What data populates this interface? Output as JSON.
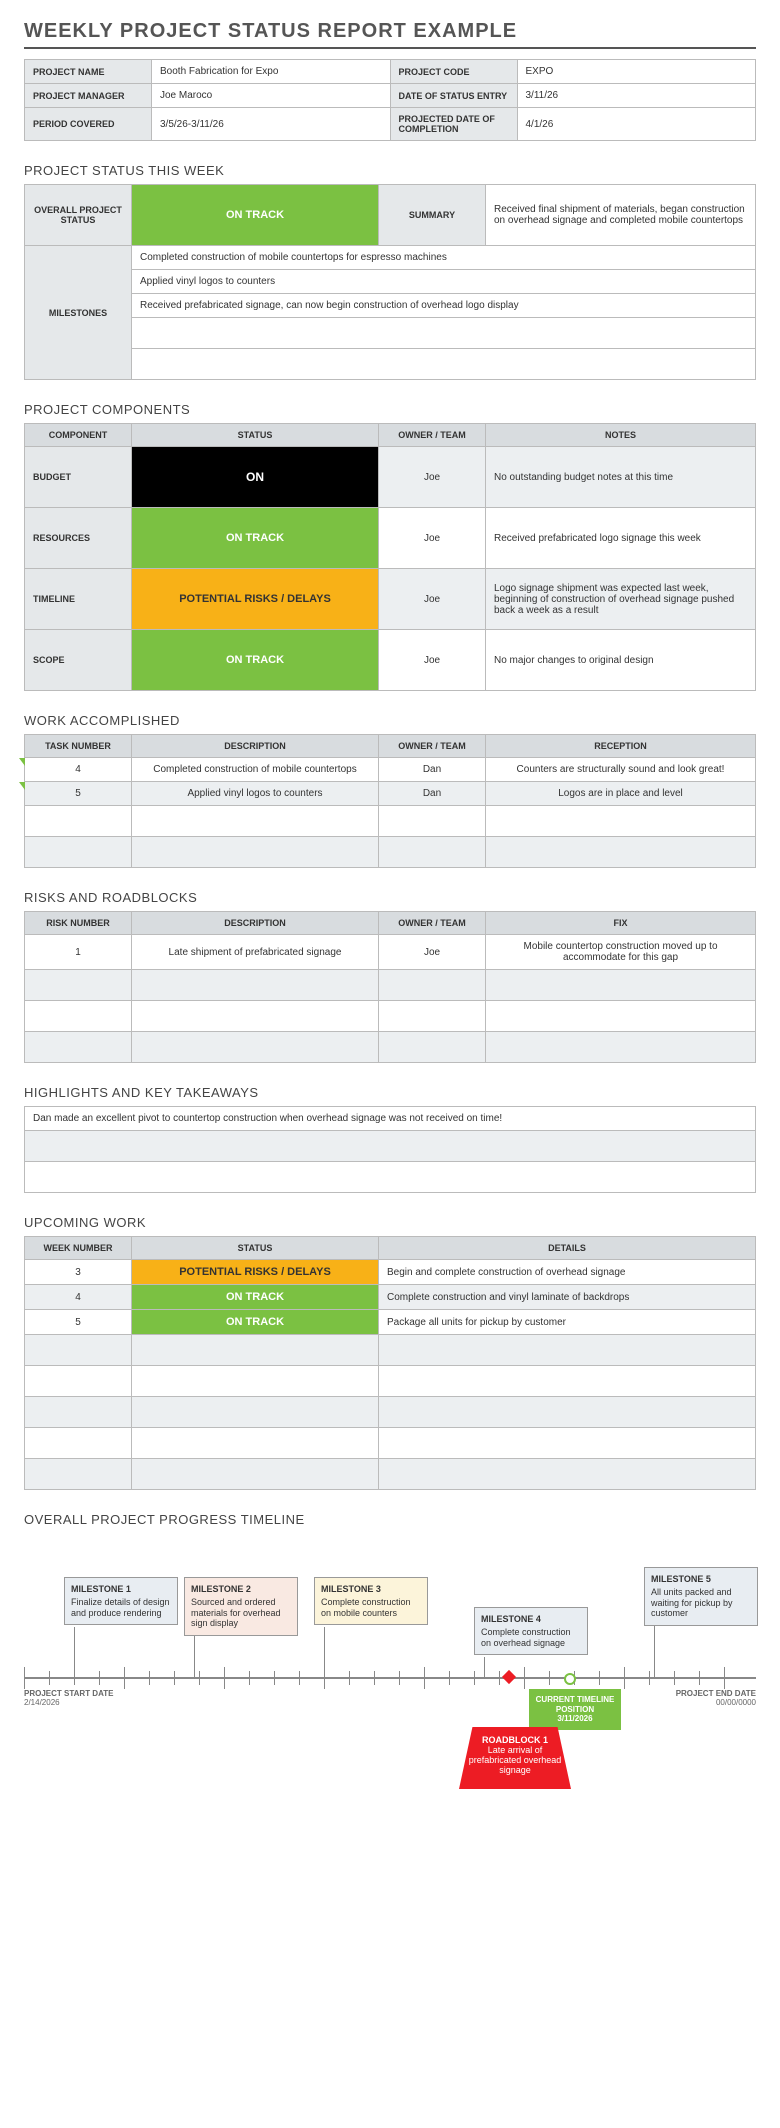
{
  "title": "WEEKLY PROJECT STATUS REPORT EXAMPLE",
  "meta": {
    "labels": {
      "name": "PROJECT NAME",
      "code": "PROJECT CODE",
      "manager": "PROJECT MANAGER",
      "entry": "DATE OF STATUS ENTRY",
      "period": "PERIOD COVERED",
      "completion": "PROJECTED DATE OF COMPLETION"
    },
    "values": {
      "name": "Booth Fabrication for Expo",
      "code": "EXPO",
      "manager": "Joe Maroco",
      "entry": "3/11/26",
      "period": "3/5/26-3/11/26",
      "completion": "4/1/26"
    }
  },
  "status_week": {
    "title": "PROJECT STATUS THIS WEEK",
    "labels": {
      "overall": "OVERALL PROJECT STATUS",
      "summary": "SUMMARY",
      "milestones": "MILESTONES"
    },
    "overall": "ON TRACK",
    "summary": "Received final shipment of materials, began construction on overhead signage and completed mobile countertops",
    "milestones": [
      "Completed construction of mobile countertops for espresso machines",
      "Applied vinyl logos to counters",
      "Received prefabricated signage, can now begin construction of overhead logo display",
      "",
      ""
    ]
  },
  "components": {
    "title": "PROJECT COMPONENTS",
    "headers": {
      "c": "COMPONENT",
      "s": "STATUS",
      "o": "OWNER / TEAM",
      "n": "NOTES"
    },
    "rows": [
      {
        "c": "BUDGET",
        "s": "ON",
        "sc": "black",
        "o": "Joe",
        "n": "No outstanding budget notes at this time"
      },
      {
        "c": "RESOURCES",
        "s": "ON TRACK",
        "sc": "green",
        "o": "Joe",
        "n": "Received prefabricated logo signage this week"
      },
      {
        "c": "TIMELINE",
        "s": "POTENTIAL RISKS / DELAYS",
        "sc": "yellow",
        "o": "Joe",
        "n": "Logo signage shipment was expected last week, beginning of construction of overhead signage pushed back a week as a result"
      },
      {
        "c": "SCOPE",
        "s": "ON TRACK",
        "sc": "green",
        "o": "Joe",
        "n": "No major changes to original design"
      }
    ]
  },
  "work": {
    "title": "WORK ACCOMPLISHED",
    "headers": {
      "t": "TASK NUMBER",
      "d": "DESCRIPTION",
      "o": "OWNER / TEAM",
      "r": "RECEPTION"
    },
    "rows": [
      {
        "t": "4",
        "d": "Completed construction of mobile countertops",
        "o": "Dan",
        "r": "Counters are structurally sound and look great!"
      },
      {
        "t": "5",
        "d": "Applied vinyl logos to counters",
        "o": "Dan",
        "r": "Logos are in place and level"
      }
    ]
  },
  "risks": {
    "title": "RISKS AND ROADBLOCKS",
    "headers": {
      "r": "RISK NUMBER",
      "d": "DESCRIPTION",
      "o": "OWNER / TEAM",
      "f": "FIX"
    },
    "rows": [
      {
        "r": "1",
        "d": "Late shipment of prefabricated signage",
        "o": "Joe",
        "f": "Mobile countertop construction moved up to accommodate for this gap"
      }
    ]
  },
  "highlights": {
    "title": "HIGHLIGHTS AND KEY TAKEAWAYS",
    "rows": [
      "Dan made an excellent pivot to countertop construction when overhead signage was not received on time!",
      "",
      ""
    ]
  },
  "upcoming": {
    "title": "UPCOMING WORK",
    "headers": {
      "w": "WEEK NUMBER",
      "s": "STATUS",
      "d": "DETAILS"
    },
    "rows": [
      {
        "w": "3",
        "s": "POTENTIAL RISKS / DELAYS",
        "sc": "yellow",
        "d": "Begin and complete construction of overhead signage"
      },
      {
        "w": "4",
        "s": "ON TRACK",
        "sc": "green",
        "d": "Complete construction and vinyl laminate of backdrops"
      },
      {
        "w": "5",
        "s": "ON TRACK",
        "sc": "green",
        "d": "Package all units for pickup by customer"
      }
    ]
  },
  "timeline": {
    "title": "OVERALL PROJECT PROGRESS TIMELINE",
    "start": {
      "label": "PROJECT START DATE",
      "date": "2/14/2026"
    },
    "end": {
      "label": "PROJECT END DATE",
      "date": "00/00/0000"
    },
    "current": {
      "label": "CURRENT TIMELINE POSITION",
      "date": "3/11/2026"
    },
    "milestones": [
      {
        "n": "MILESTONE 1",
        "t": "Finalize details of design and produce rendering",
        "bg": "#e8edf2"
      },
      {
        "n": "MILESTONE 2",
        "t": "Sourced and ordered materials for overhead sign display",
        "bg": "#f9e9e2"
      },
      {
        "n": "MILESTONE 3",
        "t": "Complete construction on mobile counters",
        "bg": "#fcf4da"
      },
      {
        "n": "MILESTONE 4",
        "t": "Complete construction on overhead signage",
        "bg": "#e8edf2"
      },
      {
        "n": "MILESTONE 5",
        "t": "All units packed and waiting for pickup by customer",
        "bg": "#e8edf2"
      }
    ],
    "roadblock": {
      "n": "ROADBLOCK 1",
      "t": "Late arrival of prefabricated overhead signage"
    }
  }
}
